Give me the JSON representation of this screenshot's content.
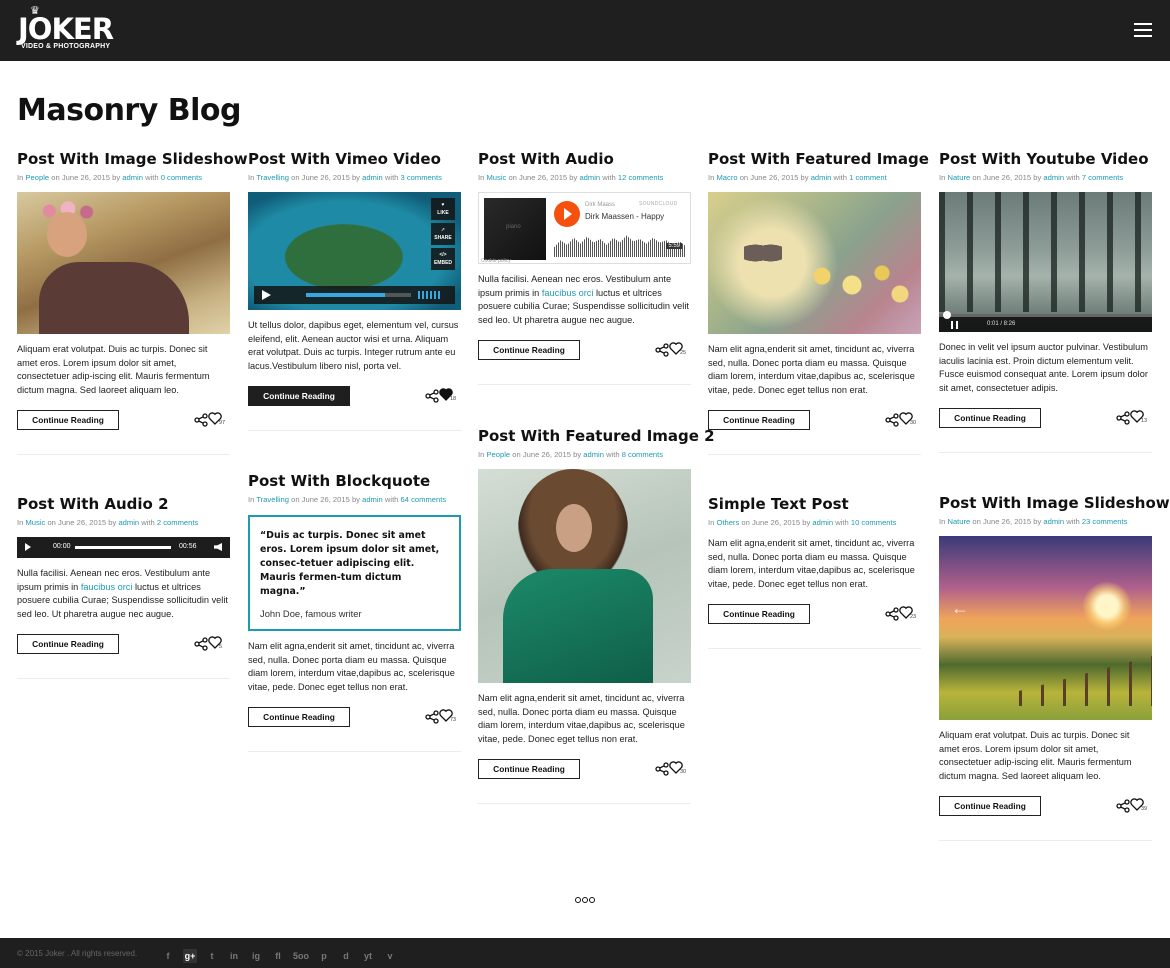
{
  "header": {
    "logo_word": "JOKER",
    "logo_tagline": "VIDEO & PHOTOGRAPHY",
    "logo_crown": "♛",
    "menu_icon": "hamburger-icon"
  },
  "page_title": "Masonry Blog",
  "common": {
    "on": "on",
    "date": "June 26, 2015",
    "by": "by",
    "author": "admin",
    "with": "with",
    "in": "In",
    "continue": "Continue Reading"
  },
  "posts": [
    {
      "title": "Post With Image Slideshow",
      "category": "People",
      "comments": "0 comments",
      "excerpt": "Aliquam erat volutpat. Duis ac turpis. Donec sit amet eros. Lorem ipsum dolor sit amet, consectetuer adip-iscing elit. Mauris fermentum dictum magna. Sed laoreet aliquam leo.",
      "likes": "97"
    },
    {
      "title": "Post With Vimeo Video",
      "category": "Travelling",
      "comments": "3 comments",
      "excerpt": "Ut tellus dolor, dapibus eget, elementum vel, cursus eleifend, elit. Aenean auctor wisi et urna. Aliquam erat volutpat. Duis ac turpis. Integer rutrum ante eu lacus.Vestibulum libero nisl, porta vel.",
      "likes": "18",
      "video": {
        "like": "LIKE",
        "share": "SHARE",
        "embed": "EMBED",
        "progress": 0.75
      }
    },
    {
      "title": "Post With Audio",
      "category": "Music",
      "comments": "12 comments",
      "excerpt_before": "Nulla facilisi. Aenean nec eros. Vestibulum ante ipsum primis in ",
      "excerpt_link": "faucibus orci",
      "excerpt_after": " luctus et ultrices posuere cubilia Curae; Suspendisse sollicitudin velit sed leo. Ut pharetra augue nec augue.",
      "likes": "25",
      "soundcloud": {
        "art_label": "piano",
        "artist": "Dirk Maass",
        "track": "Dirk Maassen - Happy",
        "brand": "SOUNDCLOUD",
        "duration": "5:59",
        "cookie": "Cookie policy"
      }
    },
    {
      "title": "Post With Featured Image",
      "category": "Macro",
      "comments": "1 comment",
      "excerpt": "Nam elit agna,enderit sit amet, tincidunt ac, viverra sed, nulla. Donec porta diam eu massa. Quisque diam lorem, interdum vitae,dapibus ac, scelerisque vitae, pede. Donec eget tellus non erat.",
      "likes": "30"
    },
    {
      "title": "Post With Youtube Video",
      "category": "Nature",
      "comments": "7 comments",
      "excerpt": "Donec in velit vel ipsum auctor pulvinar. Vestibulum iaculis lacinia est. Proin dictum elementum velit. Fusce euismod consequat ante. Lorem ipsum dolor sit amet, consectetuer adipis.",
      "likes": "13",
      "yt_time": "0:01 / 8:26"
    },
    {
      "title": "Post With Audio 2",
      "category": "Music",
      "comments": "2 comments",
      "excerpt_before": "Nulla facilisi. Aenean nec eros. Vestibulum ante ipsum primis in ",
      "excerpt_link": "faucibus orci",
      "excerpt_after": " luctus et ultrices posuere cubilia Curae; Suspendisse sollicitudin velit sed leo. Ut pharetra augue nec augue.",
      "likes": "5",
      "audio": {
        "current": "00:00",
        "total": "00:56"
      }
    },
    {
      "title": "Post With Blockquote",
      "category": "Travelling",
      "comments": "64 comments",
      "quote": "“Duis ac turpis. Donec sit amet eros. Lorem ipsum dolor sit amet, consec-tetuer adipiscing elit. Mauris fermen-tum dictum magna.”",
      "quote_author": "John Doe, famous writer",
      "excerpt": "Nam elit agna,enderit sit amet, tincidunt ac, viverra sed, nulla. Donec porta diam eu massa. Quisque diam lorem, interdum vitae,dapibus ac, scelerisque vitae, pede. Donec eget tellus non erat.",
      "likes": "73"
    },
    {
      "title": "Post With Featured Image 2",
      "category": "People",
      "comments": "8 comments",
      "excerpt": "Nam elit agna,enderit sit amet, tincidunt ac, viverra sed, nulla. Donec porta diam eu massa. Quisque diam lorem, interdum vitae,dapibus ac, scelerisque vitae, pede. Donec eget tellus non erat.",
      "likes": "30"
    },
    {
      "title": "Simple Text Post",
      "category": "Others",
      "comments": "10 comments",
      "excerpt": "Nam elit agna,enderit sit amet, tincidunt ac, viverra sed, nulla. Donec porta diam eu massa. Quisque diam lorem, interdum vitae,dapibus ac, scelerisque vitae, pede. Donec eget tellus non erat.",
      "likes": "23"
    },
    {
      "title": "Post With Image Slideshow 2",
      "category": "Nature",
      "comments": "23 comments",
      "excerpt": "Aliquam erat volutpat. Duis ac turpis. Donec sit amet eros. Lorem ipsum dolor sit amet, consectetuer adip-iscing elit. Mauris fermentum dictum magna. Sed laoreet aliquam leo.",
      "likes": "39"
    }
  ],
  "footer": {
    "copyright": "© 2015 Joker . All rights reserved.",
    "socials": [
      "f",
      "g+",
      "t",
      "in",
      "ig",
      "fl",
      "5oo",
      "p",
      "d",
      "yt",
      "v"
    ]
  },
  "colors": {
    "accent": "#1e9bb3",
    "dark": "#1f1f1f"
  }
}
